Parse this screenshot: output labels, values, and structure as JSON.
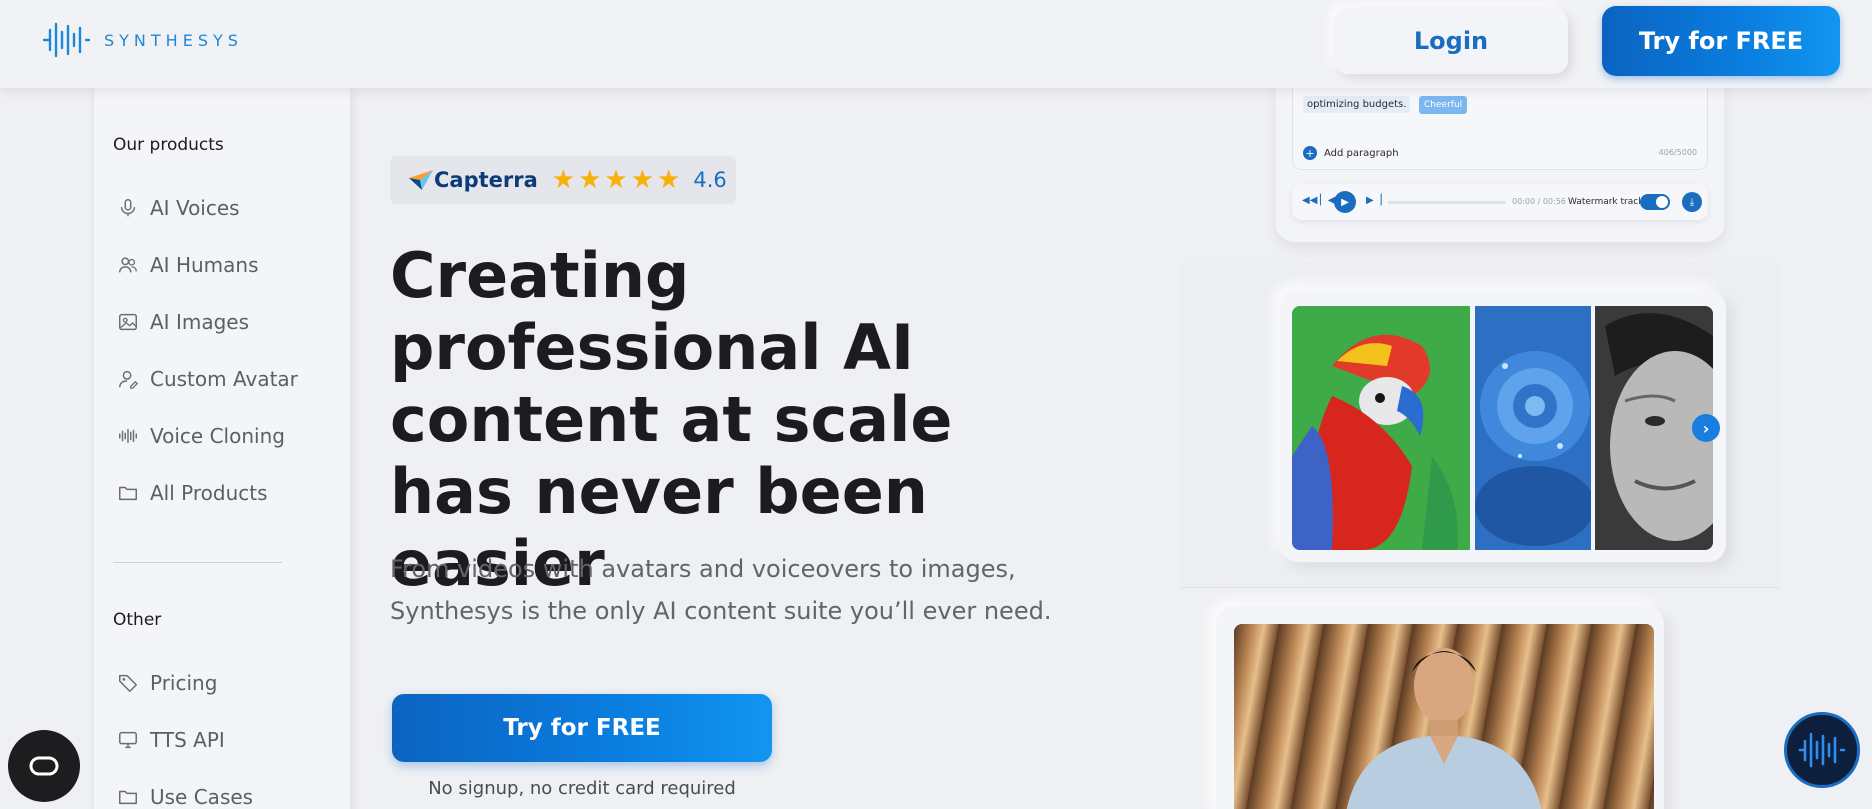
{
  "header": {
    "logo_text": "SYNTHESYS",
    "login_label": "Login",
    "try_label": "Try for FREE"
  },
  "sidebar": {
    "products_heading": "Our products",
    "products": [
      {
        "label": "AI Voices",
        "icon": "microphone-icon"
      },
      {
        "label": "AI Humans",
        "icon": "users-icon"
      },
      {
        "label": "AI Images",
        "icon": "image-icon"
      },
      {
        "label": "Custom Avatar",
        "icon": "user-edit-icon"
      },
      {
        "label": "Voice Cloning",
        "icon": "waveform-icon"
      },
      {
        "label": "All Products",
        "icon": "folder-icon"
      }
    ],
    "other_heading": "Other",
    "other": [
      {
        "label": "Pricing",
        "icon": "tag-icon"
      },
      {
        "label": "TTS API",
        "icon": "monitor-icon"
      },
      {
        "label": "Use Cases",
        "icon": "folder-icon"
      }
    ]
  },
  "hero": {
    "capterra_label": "Capterra",
    "rating": "4.6",
    "stars": 5,
    "title": "Creating professional AI content at scale has never been easier",
    "subtitle": "From videos with avatars and voiceovers to images, Synthesys is the only AI content suite you’ll ever need.",
    "cta_label": "Try for FREE",
    "note": "No signup, no credit card required"
  },
  "audio_card": {
    "text_snippet": "optimizing budgets.",
    "tone_tag": "Cheerful",
    "add_paragraph": "Add paragraph",
    "char_count": "406/5000",
    "time": "00:00 / 00:56",
    "watermark_label": "Watermark track",
    "watermark_on": true
  },
  "colors": {
    "brand_blue": "#1a6dbf",
    "accent_blue": "#0a7ee0",
    "star_yellow": "#f6b10b",
    "background": "#eff0f3"
  }
}
